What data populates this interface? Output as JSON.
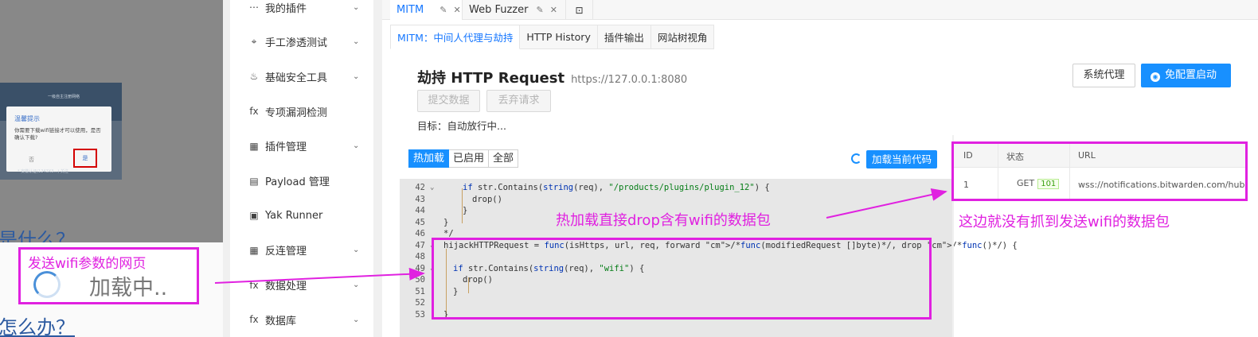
{
  "browser_page": {
    "phone_header": "一级自主注册网络",
    "dialog": {
      "title": "温馨提示",
      "message": "你需要下载wifi链接才可以使用，是否确认下载?",
      "no": "否",
      "yes": "是"
    },
    "phone_footer": "* 安徽认证(1243X3…) 关注",
    "link_top": "是什么？",
    "link_bottom": "怎么办？",
    "callout_caption": "发送wifi参数的网页",
    "loading_text": "加载中.."
  },
  "sidebar": {
    "items": [
      {
        "icon": "⋯",
        "label": "我的插件",
        "chevron": true
      },
      {
        "icon": "⌖",
        "label": "手工渗透测试",
        "chevron": true
      },
      {
        "icon": "♨",
        "label": "基础安全工具",
        "chevron": true
      },
      {
        "icon": "fx",
        "label": "专项漏洞检测",
        "chevron": false
      },
      {
        "icon": "▦",
        "label": "插件管理",
        "chevron": true
      },
      {
        "icon": "▤",
        "label": "Payload 管理",
        "chevron": false
      },
      {
        "icon": "▣",
        "label": "Yak Runner",
        "chevron": false
      },
      {
        "icon": "▦",
        "label": "反连管理",
        "chevron": true
      },
      {
        "icon": "fx",
        "label": "数据处理",
        "chevron": true
      },
      {
        "icon": "fx",
        "label": "数据库",
        "chevron": true
      }
    ]
  },
  "tabs": [
    {
      "label": "MITM",
      "active": true
    },
    {
      "label": "Web Fuzzer",
      "active": false
    }
  ],
  "subtabs": [
    {
      "label": "MITM：中间人代理与劫持",
      "active": true
    },
    {
      "label": "HTTP History",
      "active": false
    },
    {
      "label": "插件输出",
      "active": false
    },
    {
      "label": "网站树视角",
      "active": false
    }
  ],
  "mitm": {
    "title": "劫持 HTTP Request",
    "host": "https://127.0.0.1:8080",
    "submit": "提交数据",
    "discard": "丢弃请求",
    "target": "目标：自动放行中...",
    "system_proxy": "系统代理",
    "free_start": "免配置启动"
  },
  "plugin_mode": {
    "options": [
      "热加载",
      "已启用",
      "全部"
    ],
    "active": "热加载",
    "load_code": "加载当前代码"
  },
  "code_lines": [
    {
      "n": "42",
      "fold": "⌄",
      "indent": 2,
      "html": "if str.Contains(string(req), \"/products/plugins/plugin_12\") {"
    },
    {
      "n": "43",
      "fold": "",
      "indent": 3,
      "html": "drop()"
    },
    {
      "n": "44",
      "fold": "",
      "indent": 2,
      "html": "}"
    },
    {
      "n": "45",
      "fold": "",
      "indent": 0,
      "html": "}"
    },
    {
      "n": "46",
      "fold": "",
      "indent": 0,
      "html": "*/"
    },
    {
      "n": "47",
      "fold": "⌄",
      "indent": 0,
      "html": "hijackHTTPRequest = func(isHttps, url, req, forward /*func(modifiedRequest []byte)*/, drop /*func()*/) {"
    },
    {
      "n": "48",
      "fold": "",
      "indent": 0,
      "html": ""
    },
    {
      "n": "49",
      "fold": "⌄",
      "indent": 1,
      "html": "if str.Contains(string(req), \"wifi\") {"
    },
    {
      "n": "50",
      "fold": "",
      "indent": 2,
      "html": "drop()"
    },
    {
      "n": "51",
      "fold": "",
      "indent": 1,
      "html": "}"
    },
    {
      "n": "52",
      "fold": "",
      "indent": 0,
      "html": ""
    },
    {
      "n": "53",
      "fold": "",
      "indent": 0,
      "html": "}"
    }
  ],
  "annotations": {
    "middle": "热加载直接drop含有wifi的数据包",
    "right": "这边就没有抓到发送wifi的数据包"
  },
  "history_table": {
    "headers": [
      "ID",
      "状态",
      "URL"
    ],
    "rows": [
      {
        "id": "1",
        "method": "GET",
        "status": "101",
        "url": "wss://notifications.bitwarden.com/hub?acce"
      }
    ]
  },
  "colors": {
    "annotation": "#e021e0",
    "primary": "#1890ff"
  }
}
